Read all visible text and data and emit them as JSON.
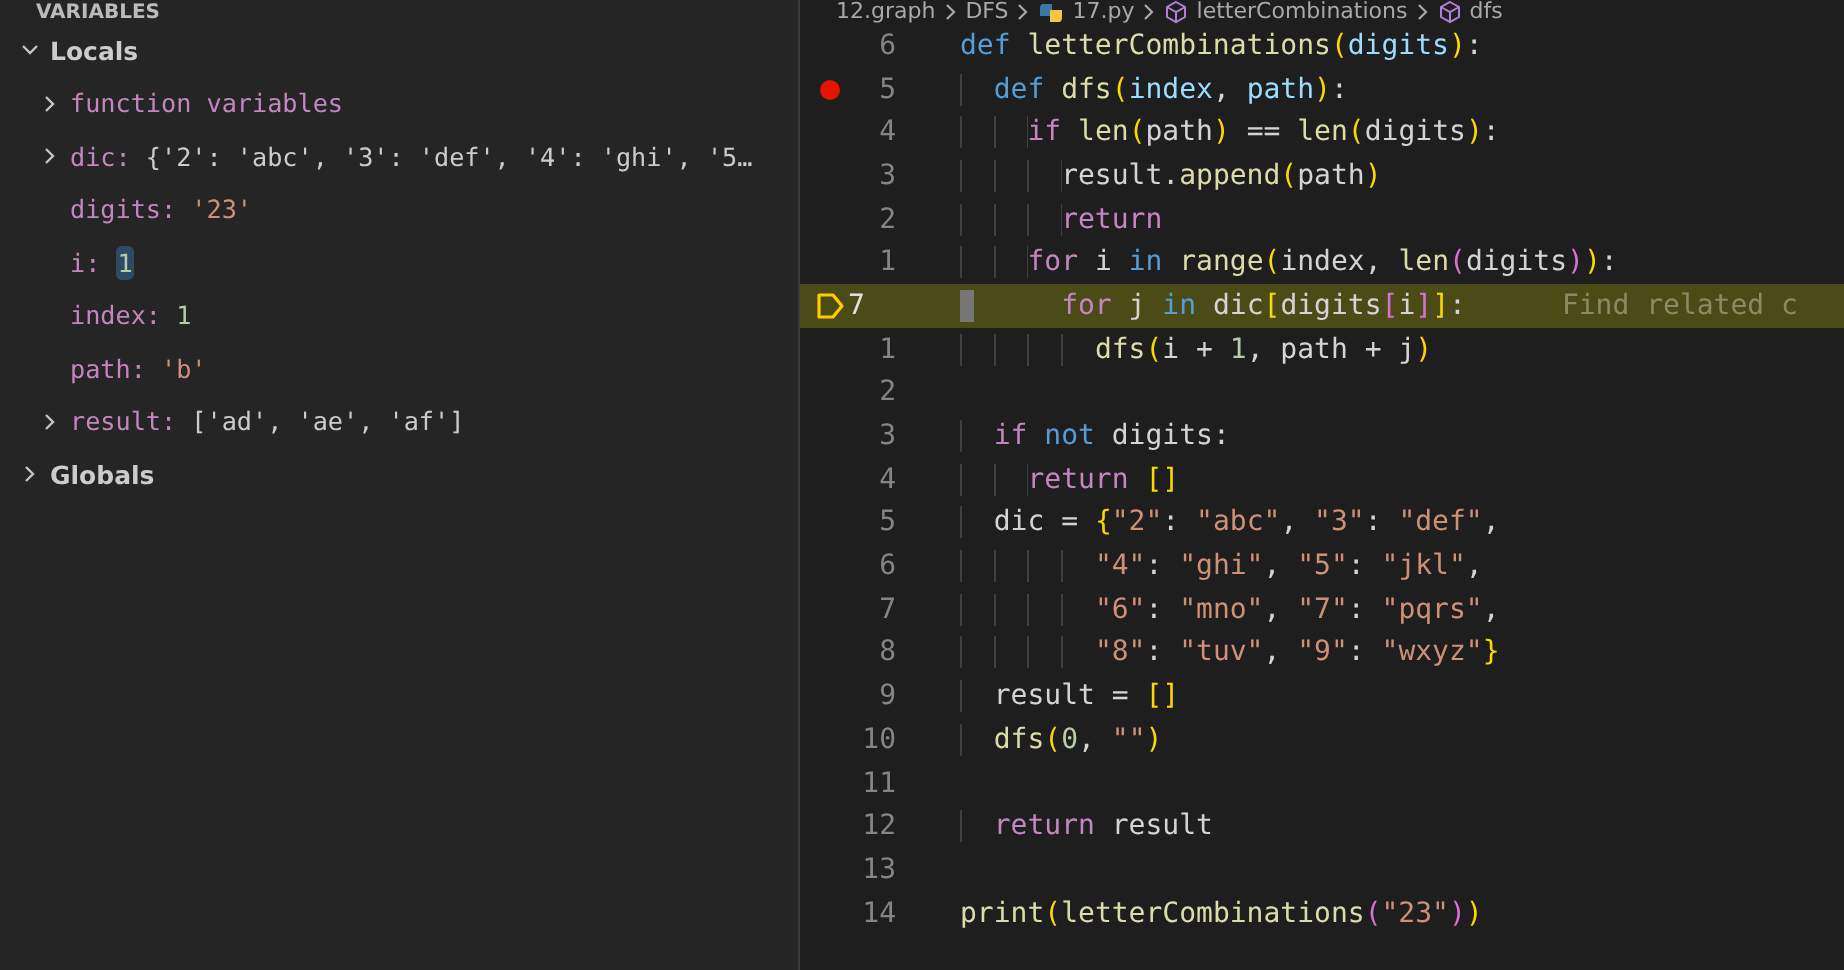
{
  "sidebar": {
    "header": "VARIABLES",
    "scopes": [
      {
        "label": "Locals",
        "expanded": true,
        "variables": [
          {
            "name": "function variables",
            "kind": "group",
            "expanded": false,
            "changed": false
          },
          {
            "name": "dic:",
            "value": "{'2': 'abc', '3': 'def', '4': 'ghi', '5…",
            "kind": "object",
            "expanded": false,
            "changed": false
          },
          {
            "name": "digits:",
            "value": "'23'",
            "kind": "string",
            "changed": false
          },
          {
            "name": "i:",
            "value": "1",
            "kind": "number",
            "changed": true
          },
          {
            "name": "index:",
            "value": "1",
            "kind": "number",
            "changed": false
          },
          {
            "name": "path:",
            "value": "'b'",
            "kind": "string",
            "changed": false
          },
          {
            "name": "result:",
            "value": "['ad', 'ae', 'af']",
            "kind": "object",
            "expanded": false,
            "changed": false
          }
        ]
      },
      {
        "label": "Globals",
        "expanded": false
      }
    ]
  },
  "editor": {
    "breadcrumb": [
      {
        "label": "12.graph",
        "kind": "folder"
      },
      {
        "label": "DFS",
        "kind": "folder"
      },
      {
        "label": "17.py",
        "kind": "python-file"
      },
      {
        "label": "letterCombinations",
        "kind": "method"
      },
      {
        "label": "dfs",
        "kind": "method"
      }
    ],
    "lines": [
      {
        "number": "6",
        "breakpoint": false,
        "current": false,
        "tokens": [
          {
            "kind": "kw",
            "text": "def "
          },
          {
            "kind": "fn",
            "text": "letterCombinations"
          },
          {
            "kind": "b1",
            "text": "("
          },
          {
            "kind": "param",
            "text": "digits"
          },
          {
            "kind": "b1",
            "text": ")"
          },
          {
            "kind": "p",
            "text": ":"
          }
        ]
      },
      {
        "number": "5",
        "breakpoint": true,
        "current": false,
        "tokens": [
          {
            "kind": "kw",
            "text": "  def "
          },
          {
            "kind": "fn",
            "text": "dfs"
          },
          {
            "kind": "b1",
            "text": "("
          },
          {
            "kind": "param",
            "text": "index"
          },
          {
            "kind": "p",
            "text": ", "
          },
          {
            "kind": "param",
            "text": "path"
          },
          {
            "kind": "b1",
            "text": ")"
          },
          {
            "kind": "p",
            "text": ":"
          }
        ]
      },
      {
        "number": "4",
        "breakpoint": false,
        "current": false,
        "tokens": [
          {
            "kind": "ctrl",
            "text": "    if "
          },
          {
            "kind": "fn",
            "text": "len"
          },
          {
            "kind": "b1",
            "text": "("
          },
          {
            "kind": "p",
            "text": "path"
          },
          {
            "kind": "b1",
            "text": ")"
          },
          {
            "kind": "p",
            "text": " == "
          },
          {
            "kind": "fn",
            "text": "len"
          },
          {
            "kind": "b1",
            "text": "("
          },
          {
            "kind": "p",
            "text": "digits"
          },
          {
            "kind": "b1",
            "text": ")"
          },
          {
            "kind": "p",
            "text": ":"
          }
        ]
      },
      {
        "number": "3",
        "breakpoint": false,
        "current": false,
        "tokens": [
          {
            "kind": "p",
            "text": "      result."
          },
          {
            "kind": "fn",
            "text": "append"
          },
          {
            "kind": "b1",
            "text": "("
          },
          {
            "kind": "p",
            "text": "path"
          },
          {
            "kind": "b1",
            "text": ")"
          }
        ]
      },
      {
        "number": "2",
        "breakpoint": false,
        "current": false,
        "tokens": [
          {
            "kind": "ctrl",
            "text": "      return"
          }
        ]
      },
      {
        "number": "1",
        "breakpoint": false,
        "current": false,
        "tokens": [
          {
            "kind": "ctrl",
            "text": "    for"
          },
          {
            "kind": "p",
            "text": " i "
          },
          {
            "kind": "kw",
            "text": "in "
          },
          {
            "kind": "fn",
            "text": "range"
          },
          {
            "kind": "b1",
            "text": "("
          },
          {
            "kind": "p",
            "text": "index, "
          },
          {
            "kind": "fn",
            "text": "len"
          },
          {
            "kind": "b2",
            "text": "("
          },
          {
            "kind": "p",
            "text": "digits"
          },
          {
            "kind": "b2",
            "text": ")"
          },
          {
            "kind": "b1",
            "text": ")"
          },
          {
            "kind": "p",
            "text": ":"
          }
        ]
      },
      {
        "number": "7",
        "breakpoint": false,
        "current": true,
        "hint": "Find related c",
        "tokens": [
          {
            "kind": "ctrl",
            "text": "      for"
          },
          {
            "kind": "p",
            "text": " j "
          },
          {
            "kind": "kw",
            "text": "in"
          },
          {
            "kind": "p",
            "text": " dic"
          },
          {
            "kind": "b1",
            "text": "["
          },
          {
            "kind": "p",
            "text": "digits"
          },
          {
            "kind": "b2",
            "text": "["
          },
          {
            "kind": "p",
            "text": "i"
          },
          {
            "kind": "b2",
            "text": "]"
          },
          {
            "kind": "b1",
            "text": "]"
          },
          {
            "kind": "p",
            "text": ":"
          }
        ]
      },
      {
        "number": "1",
        "breakpoint": false,
        "current": false,
        "tokens": [
          {
            "kind": "fn",
            "text": "        dfs"
          },
          {
            "kind": "b1",
            "text": "("
          },
          {
            "kind": "p",
            "text": "i + "
          },
          {
            "kind": "num",
            "text": "1"
          },
          {
            "kind": "p",
            "text": ", path + j"
          },
          {
            "kind": "b1",
            "text": ")"
          }
        ]
      },
      {
        "number": "2",
        "breakpoint": false,
        "current": false
      },
      {
        "number": "3",
        "breakpoint": false,
        "current": false,
        "tokens": [
          {
            "kind": "ctrl",
            "text": "  if "
          },
          {
            "kind": "kw",
            "text": "not"
          },
          {
            "kind": "p",
            "text": " digits:"
          }
        ]
      },
      {
        "number": "4",
        "breakpoint": false,
        "current": false,
        "tokens": [
          {
            "kind": "ctrl",
            "text": "    return "
          },
          {
            "kind": "b1",
            "text": "[]"
          }
        ]
      },
      {
        "number": "5",
        "breakpoint": false,
        "current": false,
        "tokens": [
          {
            "kind": "p",
            "text": "  dic = "
          },
          {
            "kind": "b1",
            "text": "{"
          },
          {
            "kind": "str",
            "text": "\"2\""
          },
          {
            "kind": "p",
            "text": ": "
          },
          {
            "kind": "str",
            "text": "\"abc\""
          },
          {
            "kind": "p",
            "text": ", "
          },
          {
            "kind": "str",
            "text": "\"3\""
          },
          {
            "kind": "p",
            "text": ": "
          },
          {
            "kind": "str",
            "text": "\"def\""
          },
          {
            "kind": "p",
            "text": ","
          }
        ]
      },
      {
        "number": "6",
        "breakpoint": false,
        "current": false,
        "tokens": [
          {
            "kind": "str",
            "text": "        \"4\""
          },
          {
            "kind": "p",
            "text": ": "
          },
          {
            "kind": "str",
            "text": "\"ghi\""
          },
          {
            "kind": "p",
            "text": ", "
          },
          {
            "kind": "str",
            "text": "\"5\""
          },
          {
            "kind": "p",
            "text": ": "
          },
          {
            "kind": "str",
            "text": "\"jkl\""
          },
          {
            "kind": "p",
            "text": ","
          }
        ]
      },
      {
        "number": "7",
        "breakpoint": false,
        "current": false,
        "tokens": [
          {
            "kind": "str",
            "text": "        \"6\""
          },
          {
            "kind": "p",
            "text": ": "
          },
          {
            "kind": "str",
            "text": "\"mno\""
          },
          {
            "kind": "p",
            "text": ", "
          },
          {
            "kind": "str",
            "text": "\"7\""
          },
          {
            "kind": "p",
            "text": ": "
          },
          {
            "kind": "str",
            "text": "\"pqrs\""
          },
          {
            "kind": "p",
            "text": ","
          }
        ]
      },
      {
        "number": "8",
        "breakpoint": false,
        "current": false,
        "tokens": [
          {
            "kind": "str",
            "text": "        \"8\""
          },
          {
            "kind": "p",
            "text": ": "
          },
          {
            "kind": "str",
            "text": "\"tuv\""
          },
          {
            "kind": "p",
            "text": ", "
          },
          {
            "kind": "str",
            "text": "\"9\""
          },
          {
            "kind": "p",
            "text": ": "
          },
          {
            "kind": "str",
            "text": "\"wxyz\""
          },
          {
            "kind": "b1",
            "text": "}"
          }
        ]
      },
      {
        "number": "9",
        "breakpoint": false,
        "current": false,
        "tokens": [
          {
            "kind": "p",
            "text": "  result = "
          },
          {
            "kind": "b1",
            "text": "[]"
          }
        ]
      },
      {
        "number": "10",
        "breakpoint": false,
        "current": false,
        "tokens": [
          {
            "kind": "fn",
            "text": "  dfs"
          },
          {
            "kind": "b1",
            "text": "("
          },
          {
            "kind": "num",
            "text": "0"
          },
          {
            "kind": "p",
            "text": ", "
          },
          {
            "kind": "str",
            "text": "\"\""
          },
          {
            "kind": "b1",
            "text": ")"
          }
        ]
      },
      {
        "number": "11",
        "breakpoint": false,
        "current": false
      },
      {
        "number": "12",
        "breakpoint": false,
        "current": false,
        "tokens": [
          {
            "kind": "ctrl",
            "text": "  return"
          },
          {
            "kind": "p",
            "text": " result"
          }
        ]
      },
      {
        "number": "13",
        "breakpoint": false,
        "current": false
      },
      {
        "number": "14",
        "breakpoint": false,
        "current": false,
        "tokens": [
          {
            "kind": "fn",
            "text": "print"
          },
          {
            "kind": "b1",
            "text": "("
          },
          {
            "kind": "fn",
            "text": "letterCombinations"
          },
          {
            "kind": "b2",
            "text": "("
          },
          {
            "kind": "str",
            "text": "\"23\""
          },
          {
            "kind": "b2",
            "text": ")"
          },
          {
            "kind": "b1",
            "text": ")"
          }
        ]
      }
    ]
  }
}
